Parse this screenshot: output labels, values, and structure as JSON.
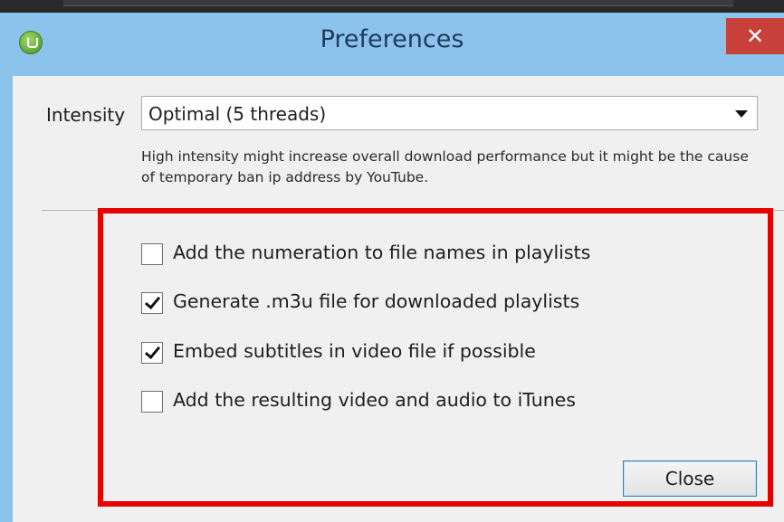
{
  "window": {
    "title": "Preferences",
    "close_symbol": "✕"
  },
  "intensity": {
    "label": "Intensity",
    "selected": "Optimal (5 threads)",
    "help_text": "High intensity might increase overall download performance but it might be the cause of temporary ban ip address by YouTube."
  },
  "options": [
    {
      "label": "Add the numeration to file names in playlists",
      "checked": false
    },
    {
      "label": "Generate .m3u file for downloaded playlists",
      "checked": true
    },
    {
      "label": "Embed subtitles in video file if possible",
      "checked": true
    },
    {
      "label": "Add the resulting video and audio to iTunes",
      "checked": false
    }
  ],
  "buttons": {
    "close_label": "Close"
  },
  "colors": {
    "titlebar": "#8cc3ec",
    "close_red": "#c8403a",
    "highlight_red": "#e60000",
    "dialog_bg": "#f0f0f0"
  },
  "icons": {
    "app": "app-logo-icon",
    "dropdown": "chevron-down-icon",
    "check": "checkmark-icon",
    "close": "close-icon"
  }
}
